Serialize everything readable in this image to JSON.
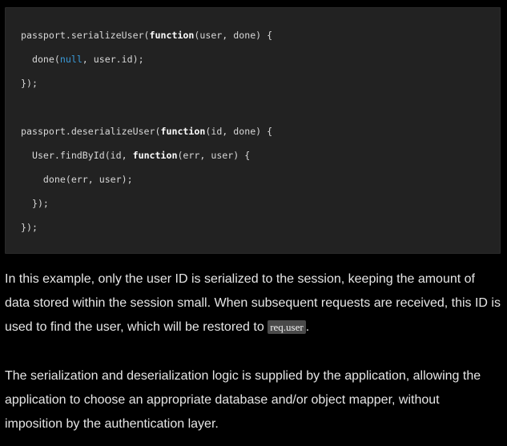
{
  "code_block": {
    "lines": [
      {
        "segments": [
          {
            "text": "passport.serializeUser(",
            "kind": "plain"
          },
          {
            "text": "function",
            "kind": "keyword"
          },
          {
            "text": "(user, done) {",
            "kind": "plain"
          }
        ]
      },
      {
        "segments": [
          {
            "text": "  done(",
            "kind": "plain"
          },
          {
            "text": "null",
            "kind": "literal"
          },
          {
            "text": ", user.id);",
            "kind": "plain"
          }
        ]
      },
      {
        "segments": [
          {
            "text": "});",
            "kind": "plain"
          }
        ]
      },
      {
        "segments": []
      },
      {
        "segments": [
          {
            "text": "passport.deserializeUser(",
            "kind": "plain"
          },
          {
            "text": "function",
            "kind": "keyword"
          },
          {
            "text": "(id, done) {",
            "kind": "plain"
          }
        ]
      },
      {
        "segments": [
          {
            "text": "  User.findById(id, ",
            "kind": "plain"
          },
          {
            "text": "function",
            "kind": "keyword"
          },
          {
            "text": "(err, user) {",
            "kind": "plain"
          }
        ]
      },
      {
        "segments": [
          {
            "text": "    done(err, user);",
            "kind": "plain"
          }
        ]
      },
      {
        "segments": [
          {
            "text": "  });",
            "kind": "plain"
          }
        ]
      },
      {
        "segments": [
          {
            "text": "});",
            "kind": "plain"
          }
        ]
      }
    ]
  },
  "paragraph_1": {
    "line_1": "In this example, only the user ID is serialized to the session, keeping the amount of",
    "line_2": "data stored within the session small. When subsequent requests are received, this ID is",
    "line_3_before": "used to find the user, which will be restored to ",
    "line_3_code": "req.user",
    "line_3_after": "."
  },
  "paragraph_2": {
    "line_1": "The serialization and deserialization logic is supplied by the application, allowing the",
    "line_2": "application to choose an appropriate database and/or object mapper, without",
    "line_3": "imposition by the authentication layer."
  },
  "colors": {
    "code_background": "#222222",
    "keyword": "#ffffff",
    "literal": "#3a9ad9",
    "text": "#e6e6e6"
  }
}
